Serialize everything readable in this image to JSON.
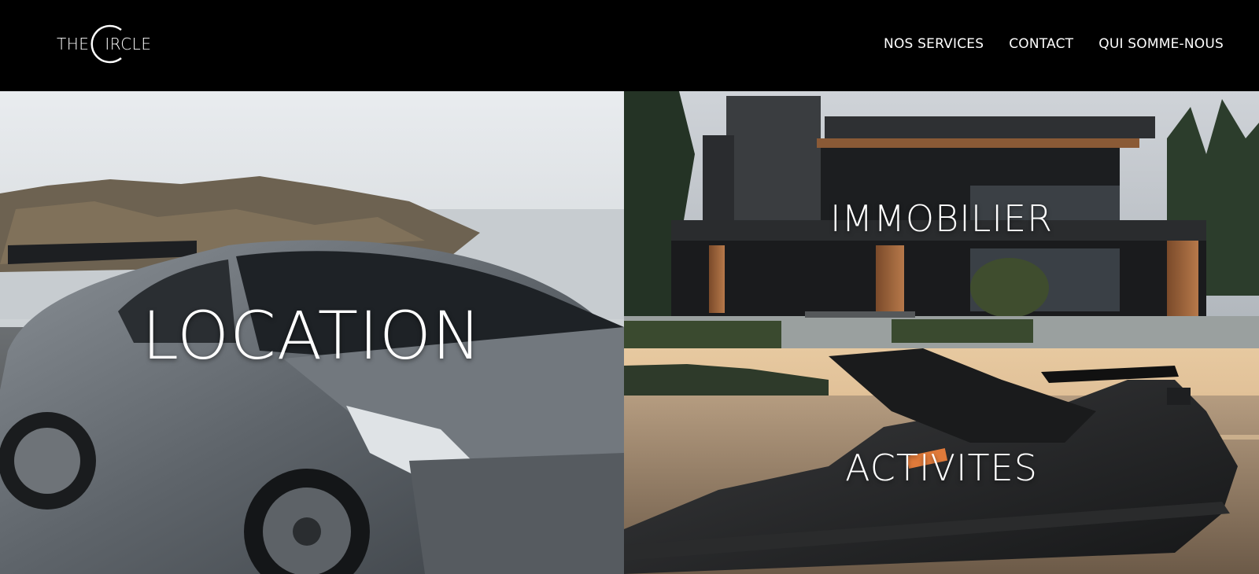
{
  "brand": {
    "logo_text_left": "THE",
    "logo_text_right": "IRCLE"
  },
  "nav": {
    "items": [
      {
        "label": "NOS SERVICES"
      },
      {
        "label": "CONTACT"
      },
      {
        "label": "QUI SOMME-NOUS"
      }
    ]
  },
  "panels": {
    "location": {
      "label": "LOCATION"
    },
    "immobilier": {
      "label": "IMMOBILIER"
    },
    "activites": {
      "label": "ACTIVITES"
    }
  },
  "icons": {
    "logo": "circle-logo-icon"
  },
  "colors": {
    "header_bg": "#000000",
    "text": "#ffffff"
  }
}
